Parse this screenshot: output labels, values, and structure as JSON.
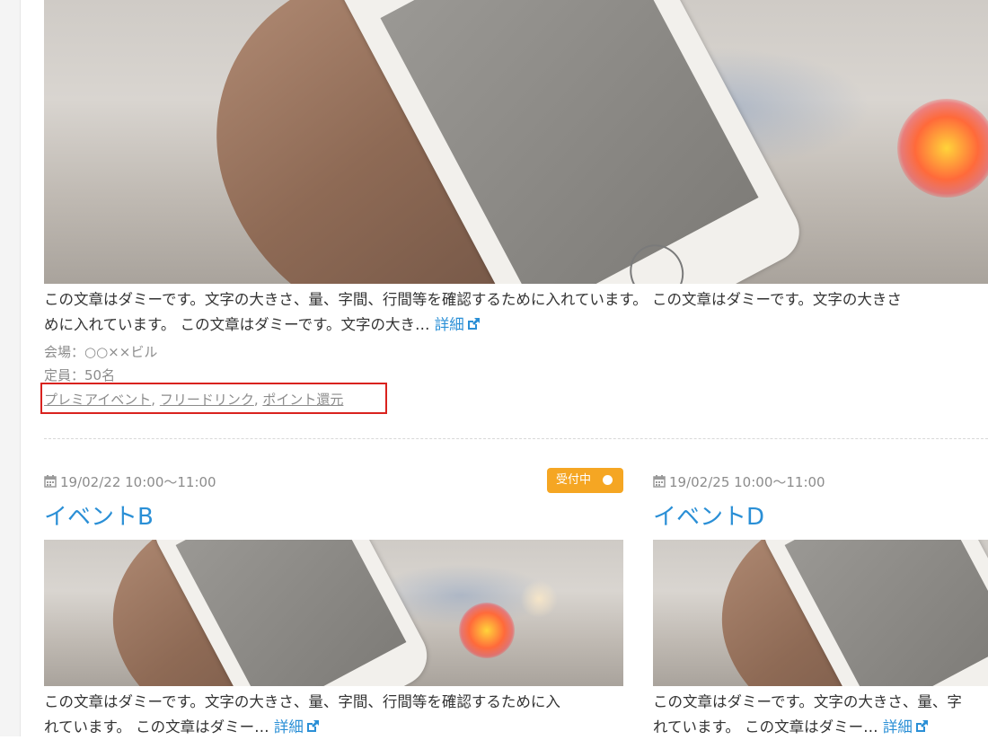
{
  "event_a": {
    "excerpt_line1": "この文章はダミーです。文字の大きさ、量、字間、行間等を確認するために入れています。 この文章はダミーです。文字の大きさ",
    "excerpt_line2": "めに入れています。 この文章はダミーです。文字の大き…",
    "detail_link": "詳細",
    "venue": "会場：○○××ビル",
    "capacity": "定員：50名",
    "tags": [
      "プレミアイベント",
      "フリードリンク",
      "ポイント還元"
    ],
    "tag_separator": ", "
  },
  "event_b": {
    "date": "19/02/22 10:00〜11:00",
    "badge": "受付中",
    "title": "イベントB",
    "excerpt_line1": "この文章はダミーです。文字の大きさ、量、字間、行間等を確認するために入",
    "excerpt_line2": "れています。 この文章はダミー…",
    "detail_link": "詳細"
  },
  "event_d": {
    "date": "19/02/25 10:00〜11:00",
    "title": "イベントD",
    "excerpt_line1": "この文章はダミーです。文字の大きさ、量、字",
    "excerpt_line2": "れています。 この文章はダミー…",
    "detail_link": "詳細"
  },
  "colors": {
    "link": "#2a8fd6",
    "badge": "#f5a623",
    "highlight": "#d9221e",
    "meta": "#8c8c8c"
  },
  "icons": {
    "calendar": "calendar-icon",
    "external_link": "external-link-icon"
  }
}
